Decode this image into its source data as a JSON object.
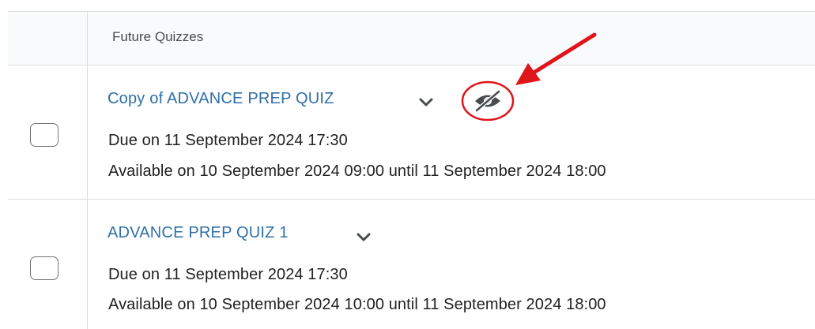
{
  "header": {
    "title": "Future Quizzes"
  },
  "quizzes": [
    {
      "title": "Copy of ADVANCE PREP QUIZ",
      "due": "Due on 11 September 2024 17:30",
      "availability": "Available on 10 September 2024 09:00 until 11 September 2024 18:00",
      "hidden_icon": "eye-slash-icon"
    },
    {
      "title": "ADVANCE PREP QUIZ 1",
      "due": "Due on 11 September 2024 17:30",
      "availability": "Available on 10 September 2024 10:00 until 11 September 2024 18:00"
    }
  ],
  "colors": {
    "link": "#2f6fa8",
    "annotation": "#e0151b",
    "border": "#d9dde2"
  }
}
